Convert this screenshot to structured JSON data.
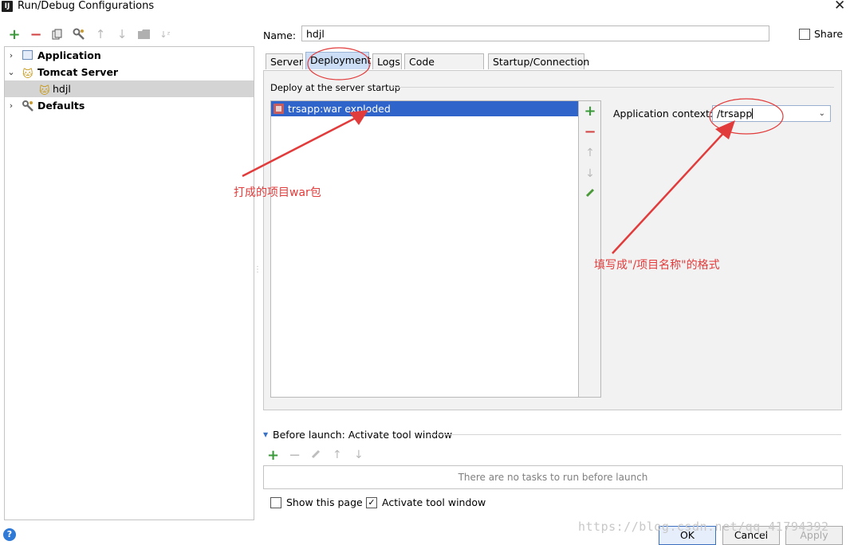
{
  "window": {
    "title": "Run/Debug Configurations",
    "close_glyph": "✕"
  },
  "toolbar": {
    "icons": [
      "add-icon",
      "remove-icon",
      "copy-icon",
      "wrench-icon",
      "arrow-up-icon",
      "arrow-down-icon",
      "folder-icon",
      "sort-icon"
    ]
  },
  "tree": {
    "items": [
      {
        "label": "Application",
        "icon": "application-icon",
        "expanded": false
      },
      {
        "label": "Tomcat Server",
        "icon": "tomcat-icon",
        "expanded": true
      },
      {
        "label": "hdjl",
        "icon": "tomcat-icon",
        "selected": true
      },
      {
        "label": "Defaults",
        "icon": "wrench-icon",
        "expanded": false
      }
    ]
  },
  "form": {
    "name_label": "Name:",
    "name_value": "hdjl",
    "share_label": "Share",
    "share_checked": false
  },
  "tabs": [
    {
      "label": "Server"
    },
    {
      "label": "Deployment",
      "active": true
    },
    {
      "label": "Logs"
    },
    {
      "label": "Code Coverage"
    },
    {
      "label": "Startup/Connection"
    }
  ],
  "deployment": {
    "section_title": "Deploy at the server startup",
    "artifacts": [
      "trsapp:war exploded"
    ],
    "context_label": "Application context:",
    "context_value": "/trsapp"
  },
  "before_launch": {
    "title": "Before launch: Activate tool window",
    "empty_text": "There are no tasks to run before launch",
    "show_page_label": "Show this page",
    "show_page_checked": false,
    "activate_label": "Activate tool window",
    "activate_checked": true
  },
  "buttons": {
    "ok": "OK",
    "cancel": "Cancel",
    "apply": "Apply"
  },
  "annotations": {
    "war_note": "打成的项目war包",
    "context_note": "填写成\"/项目名称\"的格式"
  },
  "watermark": "https://blog.csdn.net/qq_41794392",
  "colors": {
    "accent": "#2f65ca",
    "annotation": "#e23b3b",
    "add": "#3a9a3a",
    "remove": "#d34545"
  }
}
